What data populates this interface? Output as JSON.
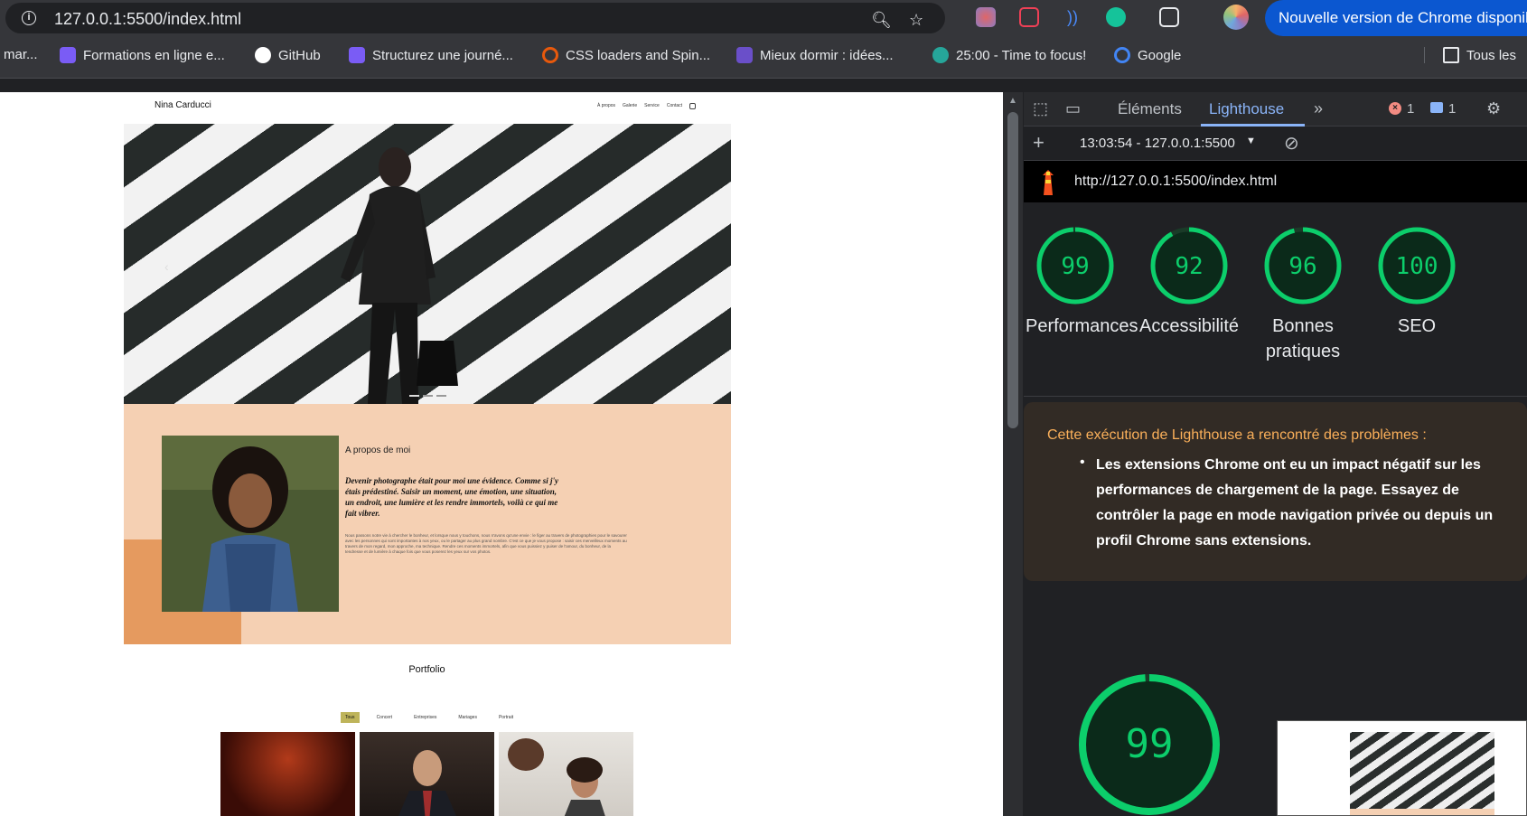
{
  "browser": {
    "url": "127.0.0.1:5500/index.html",
    "update_label": "Nouvelle version de Chrome disponible"
  },
  "bookmarks": [
    {
      "label": "mar...",
      "color": "#888"
    },
    {
      "label": "Formations en ligne e...",
      "color": "#7a5cf5"
    },
    {
      "label": "GitHub",
      "color": "#ffffff"
    },
    {
      "label": "Structurez une journé...",
      "color": "#7a5cf5"
    },
    {
      "label": "CSS loaders and Spin...",
      "color": "#e8590c"
    },
    {
      "label": "Mieux dormir : idées...",
      "color": "#6a4fc9"
    },
    {
      "label": "25:00 - Time to focus!",
      "color": "#26a69a"
    },
    {
      "label": "Google",
      "color": "#4285f4"
    },
    {
      "label": "Tous les",
      "color": "#e8eaed"
    }
  ],
  "site": {
    "brand": "Nina Carducci",
    "nav": [
      "À propos",
      "Galerie",
      "Service",
      "Contact"
    ],
    "about_title": "A propos de moi",
    "about_quote": "Devenir photographe était pour moi une évidence. Comme si j'y étais prédestiné. Saisir un moment, une émotion, une situation, un endroit, une lumière et les rendre immortels, voilà ce qui me fait vibrer.",
    "about_body": "Nous passons notre vie à chercher le bonheur, et lorsque nous y touchons, nous n'avons qu'une envie : le figer au travers de photographies pour le savourer avec les personnes qui sont importantes à nos yeux, ou le partager au plus grand nombre. C'est ce que je vous propose : saisir ces merveilleux moments au travers de mon regard, mon approche, ma technique. Rendre ces moments immortels, afin que vous puissiez y puiser de l'amour, du bonheur, de la tendresse et de lumière à chaque fois que vous poserez les yeux sur vos photos.",
    "portfolio_title": "Portfolio",
    "filters": [
      "Tous",
      "Concert",
      "Entreprises",
      "Mariages",
      "Portrait"
    ],
    "active_filter": "Tous"
  },
  "devtools": {
    "tabs": [
      "Éléments",
      "Lighthouse"
    ],
    "active_tab": "Lighthouse",
    "error_count": "1",
    "message_count": "1",
    "report_label": "13:03:54 - 127.0.0.1:5500",
    "report_url": "http://127.0.0.1:5500/index.html",
    "scores": [
      {
        "label": "Performances",
        "score": "99",
        "value": 99
      },
      {
        "label": "Accessibilité",
        "score": "92",
        "value": 92
      },
      {
        "label": "Bonnes pratiques",
        "score": "96",
        "value": 96
      },
      {
        "label": "SEO",
        "score": "100",
        "value": 100
      }
    ],
    "warning_title": "Cette exécution de Lighthouse a rencontré des problèmes :",
    "warning_item": "Les extensions Chrome ont eu un impact négatif sur les performances de chargement de la page. Essayez de contrôler la page en mode navigation privée ou depuis un profil Chrome sans extensions.",
    "big_score": "99",
    "big_score_value": 99,
    "accent_color": "#0cce6b"
  }
}
